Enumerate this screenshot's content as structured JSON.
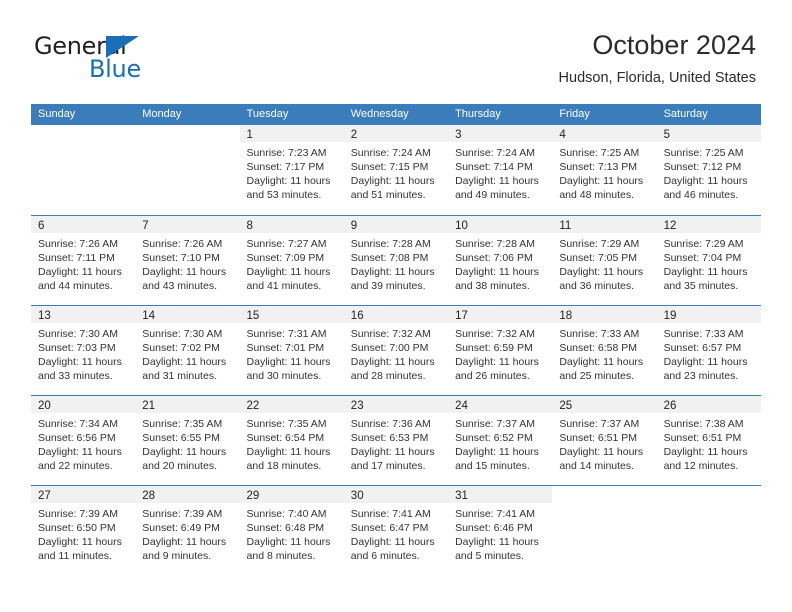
{
  "logo": {
    "word_one": "General",
    "word_two": "Blue",
    "icon": "triangle-icon",
    "accent_color": "#1b6fb8"
  },
  "header": {
    "title": "October 2024",
    "location": "Hudson, Florida, United States"
  },
  "theme": {
    "header_blue": "#3b7cba",
    "daynum_band": "#f1f1f1",
    "text": "#231f20"
  },
  "calendar": {
    "day_headers": [
      "Sunday",
      "Monday",
      "Tuesday",
      "Wednesday",
      "Thursday",
      "Friday",
      "Saturday"
    ],
    "weeks": [
      [
        {
          "day": "",
          "sunrise": "",
          "sunset": "",
          "daylight_line1": "",
          "daylight_line2": ""
        },
        {
          "day": "",
          "sunrise": "",
          "sunset": "",
          "daylight_line1": "",
          "daylight_line2": ""
        },
        {
          "day": "1",
          "sunrise": "Sunrise: 7:23 AM",
          "sunset": "Sunset: 7:17 PM",
          "daylight_line1": "Daylight: 11 hours",
          "daylight_line2": "and 53 minutes."
        },
        {
          "day": "2",
          "sunrise": "Sunrise: 7:24 AM",
          "sunset": "Sunset: 7:15 PM",
          "daylight_line1": "Daylight: 11 hours",
          "daylight_line2": "and 51 minutes."
        },
        {
          "day": "3",
          "sunrise": "Sunrise: 7:24 AM",
          "sunset": "Sunset: 7:14 PM",
          "daylight_line1": "Daylight: 11 hours",
          "daylight_line2": "and 49 minutes."
        },
        {
          "day": "4",
          "sunrise": "Sunrise: 7:25 AM",
          "sunset": "Sunset: 7:13 PM",
          "daylight_line1": "Daylight: 11 hours",
          "daylight_line2": "and 48 minutes."
        },
        {
          "day": "5",
          "sunrise": "Sunrise: 7:25 AM",
          "sunset": "Sunset: 7:12 PM",
          "daylight_line1": "Daylight: 11 hours",
          "daylight_line2": "and 46 minutes."
        }
      ],
      [
        {
          "day": "6",
          "sunrise": "Sunrise: 7:26 AM",
          "sunset": "Sunset: 7:11 PM",
          "daylight_line1": "Daylight: 11 hours",
          "daylight_line2": "and 44 minutes."
        },
        {
          "day": "7",
          "sunrise": "Sunrise: 7:26 AM",
          "sunset": "Sunset: 7:10 PM",
          "daylight_line1": "Daylight: 11 hours",
          "daylight_line2": "and 43 minutes."
        },
        {
          "day": "8",
          "sunrise": "Sunrise: 7:27 AM",
          "sunset": "Sunset: 7:09 PM",
          "daylight_line1": "Daylight: 11 hours",
          "daylight_line2": "and 41 minutes."
        },
        {
          "day": "9",
          "sunrise": "Sunrise: 7:28 AM",
          "sunset": "Sunset: 7:08 PM",
          "daylight_line1": "Daylight: 11 hours",
          "daylight_line2": "and 39 minutes."
        },
        {
          "day": "10",
          "sunrise": "Sunrise: 7:28 AM",
          "sunset": "Sunset: 7:06 PM",
          "daylight_line1": "Daylight: 11 hours",
          "daylight_line2": "and 38 minutes."
        },
        {
          "day": "11",
          "sunrise": "Sunrise: 7:29 AM",
          "sunset": "Sunset: 7:05 PM",
          "daylight_line1": "Daylight: 11 hours",
          "daylight_line2": "and 36 minutes."
        },
        {
          "day": "12",
          "sunrise": "Sunrise: 7:29 AM",
          "sunset": "Sunset: 7:04 PM",
          "daylight_line1": "Daylight: 11 hours",
          "daylight_line2": "and 35 minutes."
        }
      ],
      [
        {
          "day": "13",
          "sunrise": "Sunrise: 7:30 AM",
          "sunset": "Sunset: 7:03 PM",
          "daylight_line1": "Daylight: 11 hours",
          "daylight_line2": "and 33 minutes."
        },
        {
          "day": "14",
          "sunrise": "Sunrise: 7:30 AM",
          "sunset": "Sunset: 7:02 PM",
          "daylight_line1": "Daylight: 11 hours",
          "daylight_line2": "and 31 minutes."
        },
        {
          "day": "15",
          "sunrise": "Sunrise: 7:31 AM",
          "sunset": "Sunset: 7:01 PM",
          "daylight_line1": "Daylight: 11 hours",
          "daylight_line2": "and 30 minutes."
        },
        {
          "day": "16",
          "sunrise": "Sunrise: 7:32 AM",
          "sunset": "Sunset: 7:00 PM",
          "daylight_line1": "Daylight: 11 hours",
          "daylight_line2": "and 28 minutes."
        },
        {
          "day": "17",
          "sunrise": "Sunrise: 7:32 AM",
          "sunset": "Sunset: 6:59 PM",
          "daylight_line1": "Daylight: 11 hours",
          "daylight_line2": "and 26 minutes."
        },
        {
          "day": "18",
          "sunrise": "Sunrise: 7:33 AM",
          "sunset": "Sunset: 6:58 PM",
          "daylight_line1": "Daylight: 11 hours",
          "daylight_line2": "and 25 minutes."
        },
        {
          "day": "19",
          "sunrise": "Sunrise: 7:33 AM",
          "sunset": "Sunset: 6:57 PM",
          "daylight_line1": "Daylight: 11 hours",
          "daylight_line2": "and 23 minutes."
        }
      ],
      [
        {
          "day": "20",
          "sunrise": "Sunrise: 7:34 AM",
          "sunset": "Sunset: 6:56 PM",
          "daylight_line1": "Daylight: 11 hours",
          "daylight_line2": "and 22 minutes."
        },
        {
          "day": "21",
          "sunrise": "Sunrise: 7:35 AM",
          "sunset": "Sunset: 6:55 PM",
          "daylight_line1": "Daylight: 11 hours",
          "daylight_line2": "and 20 minutes."
        },
        {
          "day": "22",
          "sunrise": "Sunrise: 7:35 AM",
          "sunset": "Sunset: 6:54 PM",
          "daylight_line1": "Daylight: 11 hours",
          "daylight_line2": "and 18 minutes."
        },
        {
          "day": "23",
          "sunrise": "Sunrise: 7:36 AM",
          "sunset": "Sunset: 6:53 PM",
          "daylight_line1": "Daylight: 11 hours",
          "daylight_line2": "and 17 minutes."
        },
        {
          "day": "24",
          "sunrise": "Sunrise: 7:37 AM",
          "sunset": "Sunset: 6:52 PM",
          "daylight_line1": "Daylight: 11 hours",
          "daylight_line2": "and 15 minutes."
        },
        {
          "day": "25",
          "sunrise": "Sunrise: 7:37 AM",
          "sunset": "Sunset: 6:51 PM",
          "daylight_line1": "Daylight: 11 hours",
          "daylight_line2": "and 14 minutes."
        },
        {
          "day": "26",
          "sunrise": "Sunrise: 7:38 AM",
          "sunset": "Sunset: 6:51 PM",
          "daylight_line1": "Daylight: 11 hours",
          "daylight_line2": "and 12 minutes."
        }
      ],
      [
        {
          "day": "27",
          "sunrise": "Sunrise: 7:39 AM",
          "sunset": "Sunset: 6:50 PM",
          "daylight_line1": "Daylight: 11 hours",
          "daylight_line2": "and 11 minutes."
        },
        {
          "day": "28",
          "sunrise": "Sunrise: 7:39 AM",
          "sunset": "Sunset: 6:49 PM",
          "daylight_line1": "Daylight: 11 hours",
          "daylight_line2": "and 9 minutes."
        },
        {
          "day": "29",
          "sunrise": "Sunrise: 7:40 AM",
          "sunset": "Sunset: 6:48 PM",
          "daylight_line1": "Daylight: 11 hours",
          "daylight_line2": "and 8 minutes."
        },
        {
          "day": "30",
          "sunrise": "Sunrise: 7:41 AM",
          "sunset": "Sunset: 6:47 PM",
          "daylight_line1": "Daylight: 11 hours",
          "daylight_line2": "and 6 minutes."
        },
        {
          "day": "31",
          "sunrise": "Sunrise: 7:41 AM",
          "sunset": "Sunset: 6:46 PM",
          "daylight_line1": "Daylight: 11 hours",
          "daylight_line2": "and 5 minutes."
        },
        {
          "day": "",
          "sunrise": "",
          "sunset": "",
          "daylight_line1": "",
          "daylight_line2": ""
        },
        {
          "day": "",
          "sunrise": "",
          "sunset": "",
          "daylight_line1": "",
          "daylight_line2": ""
        }
      ]
    ]
  }
}
